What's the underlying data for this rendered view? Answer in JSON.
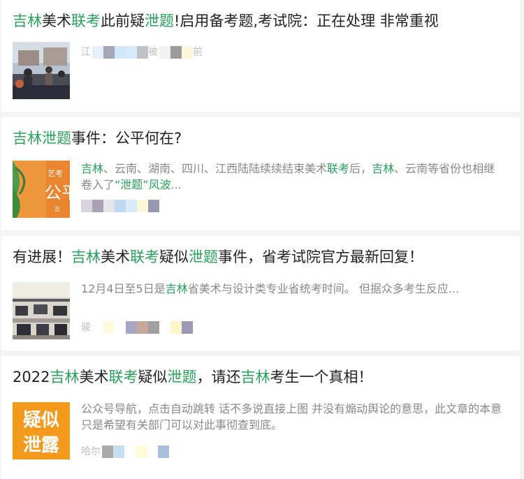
{
  "results": [
    {
      "title_parts": [
        {
          "t": "吉林",
          "hl": true
        },
        {
          "t": "美术",
          "hl": false
        },
        {
          "t": "联考",
          "hl": true
        },
        {
          "t": "此前疑",
          "hl": false
        },
        {
          "t": "泄题",
          "hl": true
        },
        {
          "t": "!启用备考题,考试院：正在处理 非常重视",
          "hl": false
        }
      ],
      "snippet_parts": [],
      "source_text": [
        "江",
        "被",
        "前"
      ],
      "blur_colors": [
        "#e6eef7",
        "#a7a6b9",
        "#cfe7f8",
        "#d9eafa",
        "#c0c0c8",
        "#f2f2f2",
        "#9b9b9b",
        "#fff6e0"
      ]
    },
    {
      "title_parts": [
        {
          "t": "吉林",
          "hl": true
        },
        {
          "t": "泄题",
          "hl": true
        },
        {
          "t": "事件：公平何在?",
          "hl": false
        }
      ],
      "snippet_parts": [
        {
          "t": "吉林",
          "hl": true
        },
        {
          "t": "、云南、湖南、四川、江西陆陆续续结束美术",
          "hl": false
        },
        {
          "t": "联考",
          "hl": true
        },
        {
          "t": "后，",
          "hl": false
        },
        {
          "t": "吉林",
          "hl": true
        },
        {
          "t": "、云南等省份也相继卷入了",
          "hl": false
        },
        {
          "t": "“泄题”",
          "hl": true
        },
        {
          "t": "风波",
          "hl": true
        },
        {
          "t": "...",
          "hl": false
        }
      ],
      "thumb_text": [
        "艺考",
        "公平",
        "吉"
      ],
      "source_text": [],
      "blur_colors": [
        "#d8d4e0",
        "#a8a2b4",
        "#e6e6ea",
        "#bfd9f4",
        "#d8ecfa",
        "#fff8d8",
        "#9a98b0"
      ]
    },
    {
      "title_parts": [
        {
          "t": "有进展！",
          "hl": false
        },
        {
          "t": "吉林",
          "hl": true
        },
        {
          "t": "美术",
          "hl": false
        },
        {
          "t": "联考",
          "hl": true
        },
        {
          "t": "疑似",
          "hl": false
        },
        {
          "t": "泄题",
          "hl": true
        },
        {
          "t": "事件，省考试院官方最新回复！",
          "hl": false
        }
      ],
      "snippet_parts": [
        {
          "t": "12月4日至5日是",
          "hl": false
        },
        {
          "t": "吉林",
          "hl": true
        },
        {
          "t": "省美术与设计类专业省统考时间。 但据众多考生反应...",
          "hl": false
        }
      ],
      "source_text": [
        "骏"
      ],
      "blur_colors": [
        "#ffffff",
        "#fff9e0",
        "#ffffff",
        "#a7a5c0",
        "#c9a79a",
        "#a0a0a0",
        "#ffffff",
        "#fff6c8",
        "#9b99b6"
      ]
    },
    {
      "title_parts": [
        {
          "t": "2022",
          "hl": false
        },
        {
          "t": "吉林",
          "hl": true
        },
        {
          "t": "美术",
          "hl": false
        },
        {
          "t": "联考",
          "hl": true
        },
        {
          "t": "疑似",
          "hl": false
        },
        {
          "t": "泄题",
          "hl": true
        },
        {
          "t": "，请还",
          "hl": false
        },
        {
          "t": "吉林",
          "hl": true
        },
        {
          "t": "考生一个真相！",
          "hl": false
        }
      ],
      "snippet_parts": [
        {
          "t": "公众号导航，点击自动跳转 话不多说直接上图 并没有煽动舆论的意思，此文章的本意只是希望有关部门可以对此事彻查到底。",
          "hl": false
        }
      ],
      "thumb_text": [
        "疑似",
        "泄露"
      ],
      "source_text": [
        "哈尔"
      ],
      "blur_colors": [
        "#aaaaaa",
        "#c5def0",
        "#ffffff",
        "#fffbd8",
        "#ffffff",
        "#a8c0dc"
      ]
    }
  ]
}
